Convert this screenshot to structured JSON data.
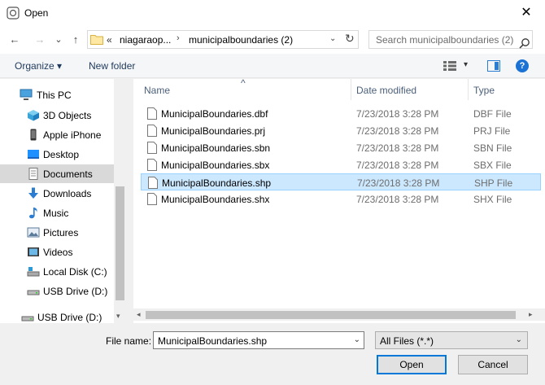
{
  "window": {
    "title": "Open",
    "close_glyph": "✕"
  },
  "nav": {
    "back_glyph": "←",
    "forward_glyph": "→",
    "recent_glyph": "⌄",
    "up_glyph": "↑",
    "address_chevrons": "«",
    "address_segments": [
      "niagaraop...",
      "municipalboundaries (2)"
    ],
    "address_separator": "›",
    "address_dropdown_glyph": "⌄",
    "refresh_glyph": "↻",
    "search_placeholder": "Search municipalboundaries (2)"
  },
  "toolbar": {
    "organize_label": "Organize ▾",
    "new_folder_label": "New folder",
    "view_dropdown_glyph": "▾",
    "help_glyph": "?"
  },
  "sidebar": {
    "items": [
      {
        "label": "This PC",
        "icon": "pc-icon"
      },
      {
        "label": "3D Objects",
        "icon": "cube-icon"
      },
      {
        "label": "Apple iPhone",
        "icon": "phone-icon"
      },
      {
        "label": "Desktop",
        "icon": "desktop-icon"
      },
      {
        "label": "Documents",
        "icon": "documents-icon",
        "selected": true
      },
      {
        "label": "Downloads",
        "icon": "download-icon"
      },
      {
        "label": "Music",
        "icon": "music-icon"
      },
      {
        "label": "Pictures",
        "icon": "pictures-icon"
      },
      {
        "label": "Videos",
        "icon": "videos-icon"
      },
      {
        "label": "Local Disk (C:)",
        "icon": "disk-icon"
      },
      {
        "label": "USB Drive (D:)",
        "icon": "usb-drive-icon"
      },
      {
        "label": "USB Drive (D:)",
        "icon": "usb-drive-icon"
      }
    ],
    "scroll_down_glyph": "▾"
  },
  "filelist": {
    "columns": [
      "Name",
      "Date modified",
      "Type"
    ],
    "sort_glyph": "^",
    "rows": [
      {
        "name": "MunicipalBoundaries.dbf",
        "date": "7/23/2018 3:28 PM",
        "type": "DBF File"
      },
      {
        "name": "MunicipalBoundaries.prj",
        "date": "7/23/2018 3:28 PM",
        "type": "PRJ File"
      },
      {
        "name": "MunicipalBoundaries.sbn",
        "date": "7/23/2018 3:28 PM",
        "type": "SBN File"
      },
      {
        "name": "MunicipalBoundaries.sbx",
        "date": "7/23/2018 3:28 PM",
        "type": "SBX File"
      },
      {
        "name": "MunicipalBoundaries.shp",
        "date": "7/23/2018 3:28 PM",
        "type": "SHP File",
        "selected": true
      },
      {
        "name": "MunicipalBoundaries.shx",
        "date": "7/23/2018 3:28 PM",
        "type": "SHX File"
      }
    ],
    "scroll_left_glyph": "◂",
    "scroll_right_glyph": "▸"
  },
  "footer": {
    "file_name_label": "File name:",
    "file_name_value": "MunicipalBoundaries.shp",
    "file_name_dropdown_glyph": "⌄",
    "filter_value": "All Files (*.*)",
    "filter_dropdown_glyph": "⌄",
    "open_label": "Open",
    "cancel_label": "Cancel"
  }
}
